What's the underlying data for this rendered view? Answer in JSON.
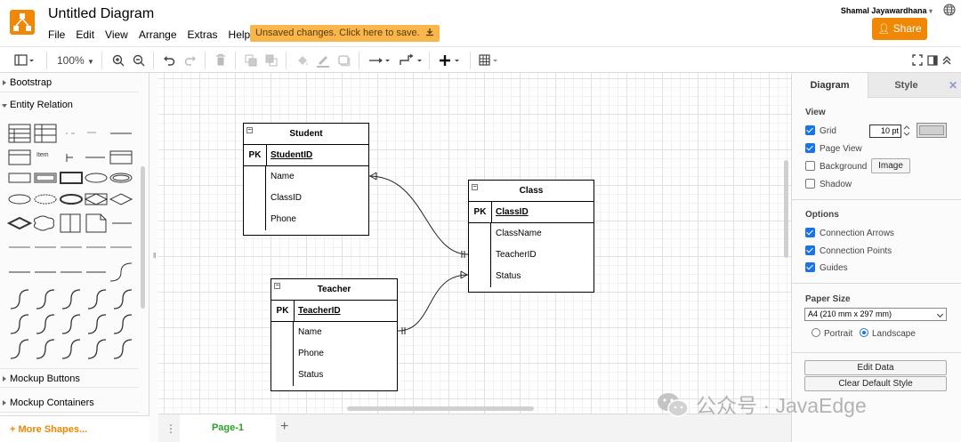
{
  "header": {
    "title": "Untitled Diagram",
    "menu": [
      "File",
      "Edit",
      "View",
      "Arrange",
      "Extras",
      "Help"
    ],
    "unsaved_notice": "Unsaved changes. Click here to save.",
    "user_name": "Shamal Jayawardhana",
    "share_label": "Share"
  },
  "toolbar": {
    "zoom_level": "100%",
    "icons": [
      "format-panel-icon",
      "zoom-in-icon",
      "zoom-out-icon",
      "undo-icon",
      "redo-icon",
      "delete-icon",
      "to-front-icon",
      "to-back-icon",
      "fill-color-icon",
      "line-color-icon",
      "shadow-icon",
      "connection-icon",
      "waypoints-icon",
      "insert-icon",
      "table-icon",
      "fullscreen-icon",
      "toggle-panel-icon",
      "collapse-icon"
    ]
  },
  "sidebar": {
    "sections": [
      {
        "label": "Bootstrap",
        "expanded": false
      },
      {
        "label": "Entity Relation",
        "expanded": true
      },
      {
        "label": "Mockup Buttons",
        "expanded": false
      },
      {
        "label": "Mockup Containers",
        "expanded": false
      }
    ],
    "shape_item_label": "Item",
    "more_shapes": "+ More Shapes..."
  },
  "diagram": {
    "tables": [
      {
        "name": "Student",
        "pk_label": "PK",
        "pk": "StudentID",
        "fields": [
          "Name",
          "ClassID",
          "Phone"
        ]
      },
      {
        "name": "Class",
        "pk_label": "PK",
        "pk": "ClassID",
        "fields": [
          "ClassName",
          "TeacherID",
          "Status"
        ]
      },
      {
        "name": "Teacher",
        "pk_label": "PK",
        "pk": "TeacherID",
        "fields": [
          "Name",
          "Phone",
          "Status"
        ]
      }
    ],
    "collapse_glyph": "−"
  },
  "pages": {
    "active": "Page-1",
    "menu_glyph": "⋮",
    "add_glyph": "+"
  },
  "format_panel": {
    "tabs": [
      "Diagram",
      "Style"
    ],
    "close_glyph": "✕",
    "view_heading": "View",
    "grid_label": "Grid",
    "grid_checked": true,
    "grid_size": "10 pt",
    "page_view_label": "Page View",
    "page_view_checked": true,
    "background_label": "Background",
    "background_checked": false,
    "image_button": "Image",
    "shadow_label": "Shadow",
    "shadow_checked": false,
    "options_heading": "Options",
    "connection_arrows_label": "Connection Arrows",
    "connection_points_label": "Connection Points",
    "guides_label": "Guides",
    "paper_size_heading": "Paper Size",
    "paper_size_value": "A4 (210 mm x 297 mm)",
    "portrait_label": "Portrait",
    "landscape_label": "Landscape",
    "orientation": "Landscape",
    "edit_data_button": "Edit Data",
    "clear_style_button": "Clear Default Style"
  },
  "watermark": {
    "text": "公众号 · JavaEdge"
  },
  "colors": {
    "brand": "#f08705",
    "unsaved": "#f9b64c",
    "checkbox": "#1a73e8",
    "page_tab": "#2a9f2a"
  }
}
